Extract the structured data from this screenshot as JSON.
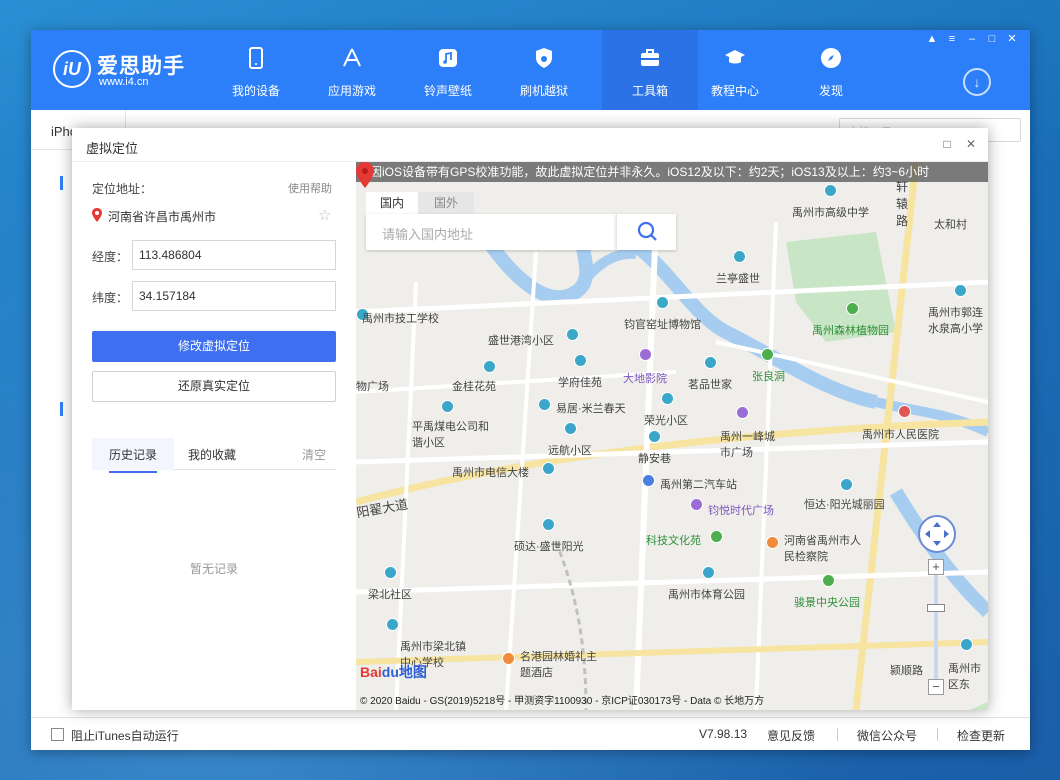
{
  "app": {
    "logo_mark": "iU",
    "logo_name": "爱思助手",
    "logo_url": "www.i4.cn",
    "nav": [
      {
        "label": "我的设备",
        "icon": "phone-icon"
      },
      {
        "label": "应用游戏",
        "icon": "appstore-icon"
      },
      {
        "label": "铃声壁纸",
        "icon": "music-icon"
      },
      {
        "label": "刷机越狱",
        "icon": "shield-icon"
      },
      {
        "label": "工具箱",
        "icon": "toolbox-icon"
      },
      {
        "label": "教程中心",
        "icon": "graduation-cap-icon"
      },
      {
        "label": "发现",
        "icon": "compass-icon"
      }
    ],
    "active_nav": "工具箱",
    "device_tab": "iPhone",
    "bg_search_placeholder": "查找工具"
  },
  "status": {
    "itunes_label": "阻止iTunes自动运行",
    "itunes_checked": false,
    "version": "V7.98.13",
    "feedback": "意见反馈",
    "wechat": "微信公众号",
    "update": "检查更新"
  },
  "dialog": {
    "title": "虚拟定位",
    "location_label": "定位地址：",
    "help": "使用帮助",
    "address": "河南省许昌市禹州市",
    "longitude_label": "经度：",
    "longitude": "113.486804",
    "latitude_label": "纬度：",
    "latitude": "34.157184",
    "modify_button": "修改虚拟定位",
    "restore_button": "还原真实定位",
    "tabs": [
      "历史记录",
      "我的收藏"
    ],
    "clear": "清空",
    "empty_text": "暂无记录"
  },
  "map": {
    "notice": "因iOS设备带有GPS校准功能，故此虚拟定位并非永久。iOS12及以下：约2天；iOS13及以上：约3~6小时",
    "tab_domestic": "国内",
    "tab_foreign": "国外",
    "search_placeholder": "请输入国内地址",
    "brand_red": "Bai",
    "brand_blue": "du地图",
    "copyright": "© 2020 Baidu - GS(2019)5218号 - 甲测资字1100930 - 京ICP证030173号 - Data © 长地万方",
    "labels": [
      {
        "text": "禹州市高级中学",
        "type": "poi"
      },
      {
        "text": "太和村",
        "type": "plain"
      },
      {
        "text": "轩辕路",
        "type": "road"
      },
      {
        "text": "兰亭盛世",
        "type": "poi"
      },
      {
        "text": "禹州市技工学校",
        "type": "poi"
      },
      {
        "text": "钧官窑址博物馆",
        "type": "poi"
      },
      {
        "text": "禹州市郭连水泉高小学",
        "type": "poi"
      },
      {
        "text": "禹州森林植物园",
        "type": "green"
      },
      {
        "text": "盛世港湾小区",
        "type": "poi"
      },
      {
        "text": "大地影院",
        "type": "purple"
      },
      {
        "text": "张良洞",
        "type": "green"
      },
      {
        "text": "金桂花苑",
        "type": "poi"
      },
      {
        "text": "学府佳苑",
        "type": "poi"
      },
      {
        "text": "茗品世家",
        "type": "poi"
      },
      {
        "text": "物广场",
        "type": "plain"
      },
      {
        "text": "易居·米兰春天",
        "type": "poi"
      },
      {
        "text": "荣光小区",
        "type": "poi"
      },
      {
        "text": "平禹煤电公司和谐小区",
        "type": "poi"
      },
      {
        "text": "远航小区",
        "type": "poi"
      },
      {
        "text": "静安巷",
        "type": "poi"
      },
      {
        "text": "禹州一峰城市广场",
        "type": "poi"
      },
      {
        "text": "禹州市人民医院",
        "type": "red"
      },
      {
        "text": "禹州市电信大楼",
        "type": "poi"
      },
      {
        "text": "禹州第二汽车站",
        "type": "poi"
      },
      {
        "text": "阳翟大道",
        "type": "road"
      },
      {
        "text": "钧悦时代广场",
        "type": "purple"
      },
      {
        "text": "恒达·阳光城丽园",
        "type": "poi"
      },
      {
        "text": "硕达·盛世阳光",
        "type": "poi"
      },
      {
        "text": "科技文化苑",
        "type": "green"
      },
      {
        "text": "河南省禹州市人民检察院",
        "type": "poi"
      },
      {
        "text": "梁北社区",
        "type": "poi"
      },
      {
        "text": "禹州市体育公园",
        "type": "poi"
      },
      {
        "text": "骏景中央公园",
        "type": "green"
      },
      {
        "text": "禹州市梁北镇中心学校",
        "type": "poi"
      },
      {
        "text": "名港园林婚礼主题酒店",
        "type": "poi"
      },
      {
        "text": "颍顺路",
        "type": "road"
      },
      {
        "text": "禹州市区东",
        "type": "poi"
      }
    ],
    "colors": {
      "water": "#a6cdf0",
      "green_area": "#c8e6c5",
      "road": "#ffffff",
      "main_road": "#f7e4a0"
    }
  },
  "colors": {
    "brand_blue": "#2d7ff9",
    "button_blue": "#3d6ff0",
    "marker_red": "#e53935"
  }
}
